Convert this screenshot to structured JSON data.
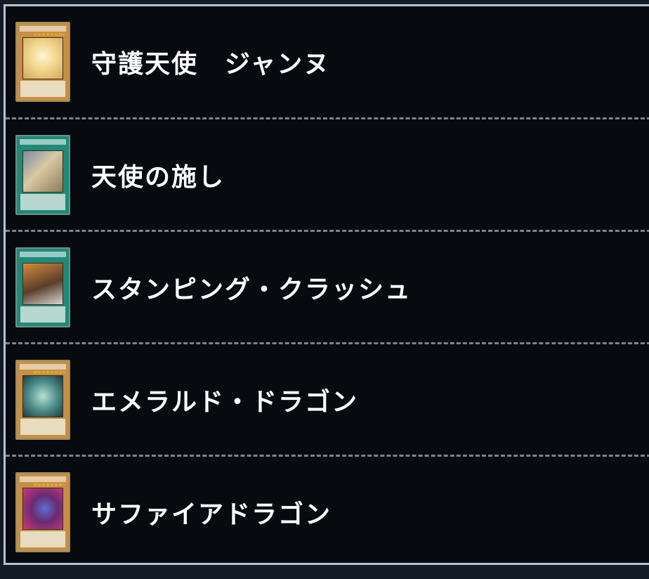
{
  "card_list": {
    "items": [
      {
        "name": "守護天使　ジャンヌ",
        "card_type": "monster",
        "art": "angel"
      },
      {
        "name": "天使の施し",
        "card_type": "spell",
        "art": "charity"
      },
      {
        "name": "スタンピング・クラッシュ",
        "card_type": "spell",
        "art": "stamping"
      },
      {
        "name": "エメラルド・ドラゴン",
        "card_type": "monster",
        "art": "emerald"
      },
      {
        "name": "サファイアドラゴン",
        "card_type": "monster",
        "art": "sapphire"
      }
    ]
  },
  "colors": {
    "background": "#121b26",
    "panel": "#070a0f",
    "panel_border": "#b9c3cd",
    "divider": "#7b838c",
    "text": "#ffffff"
  }
}
